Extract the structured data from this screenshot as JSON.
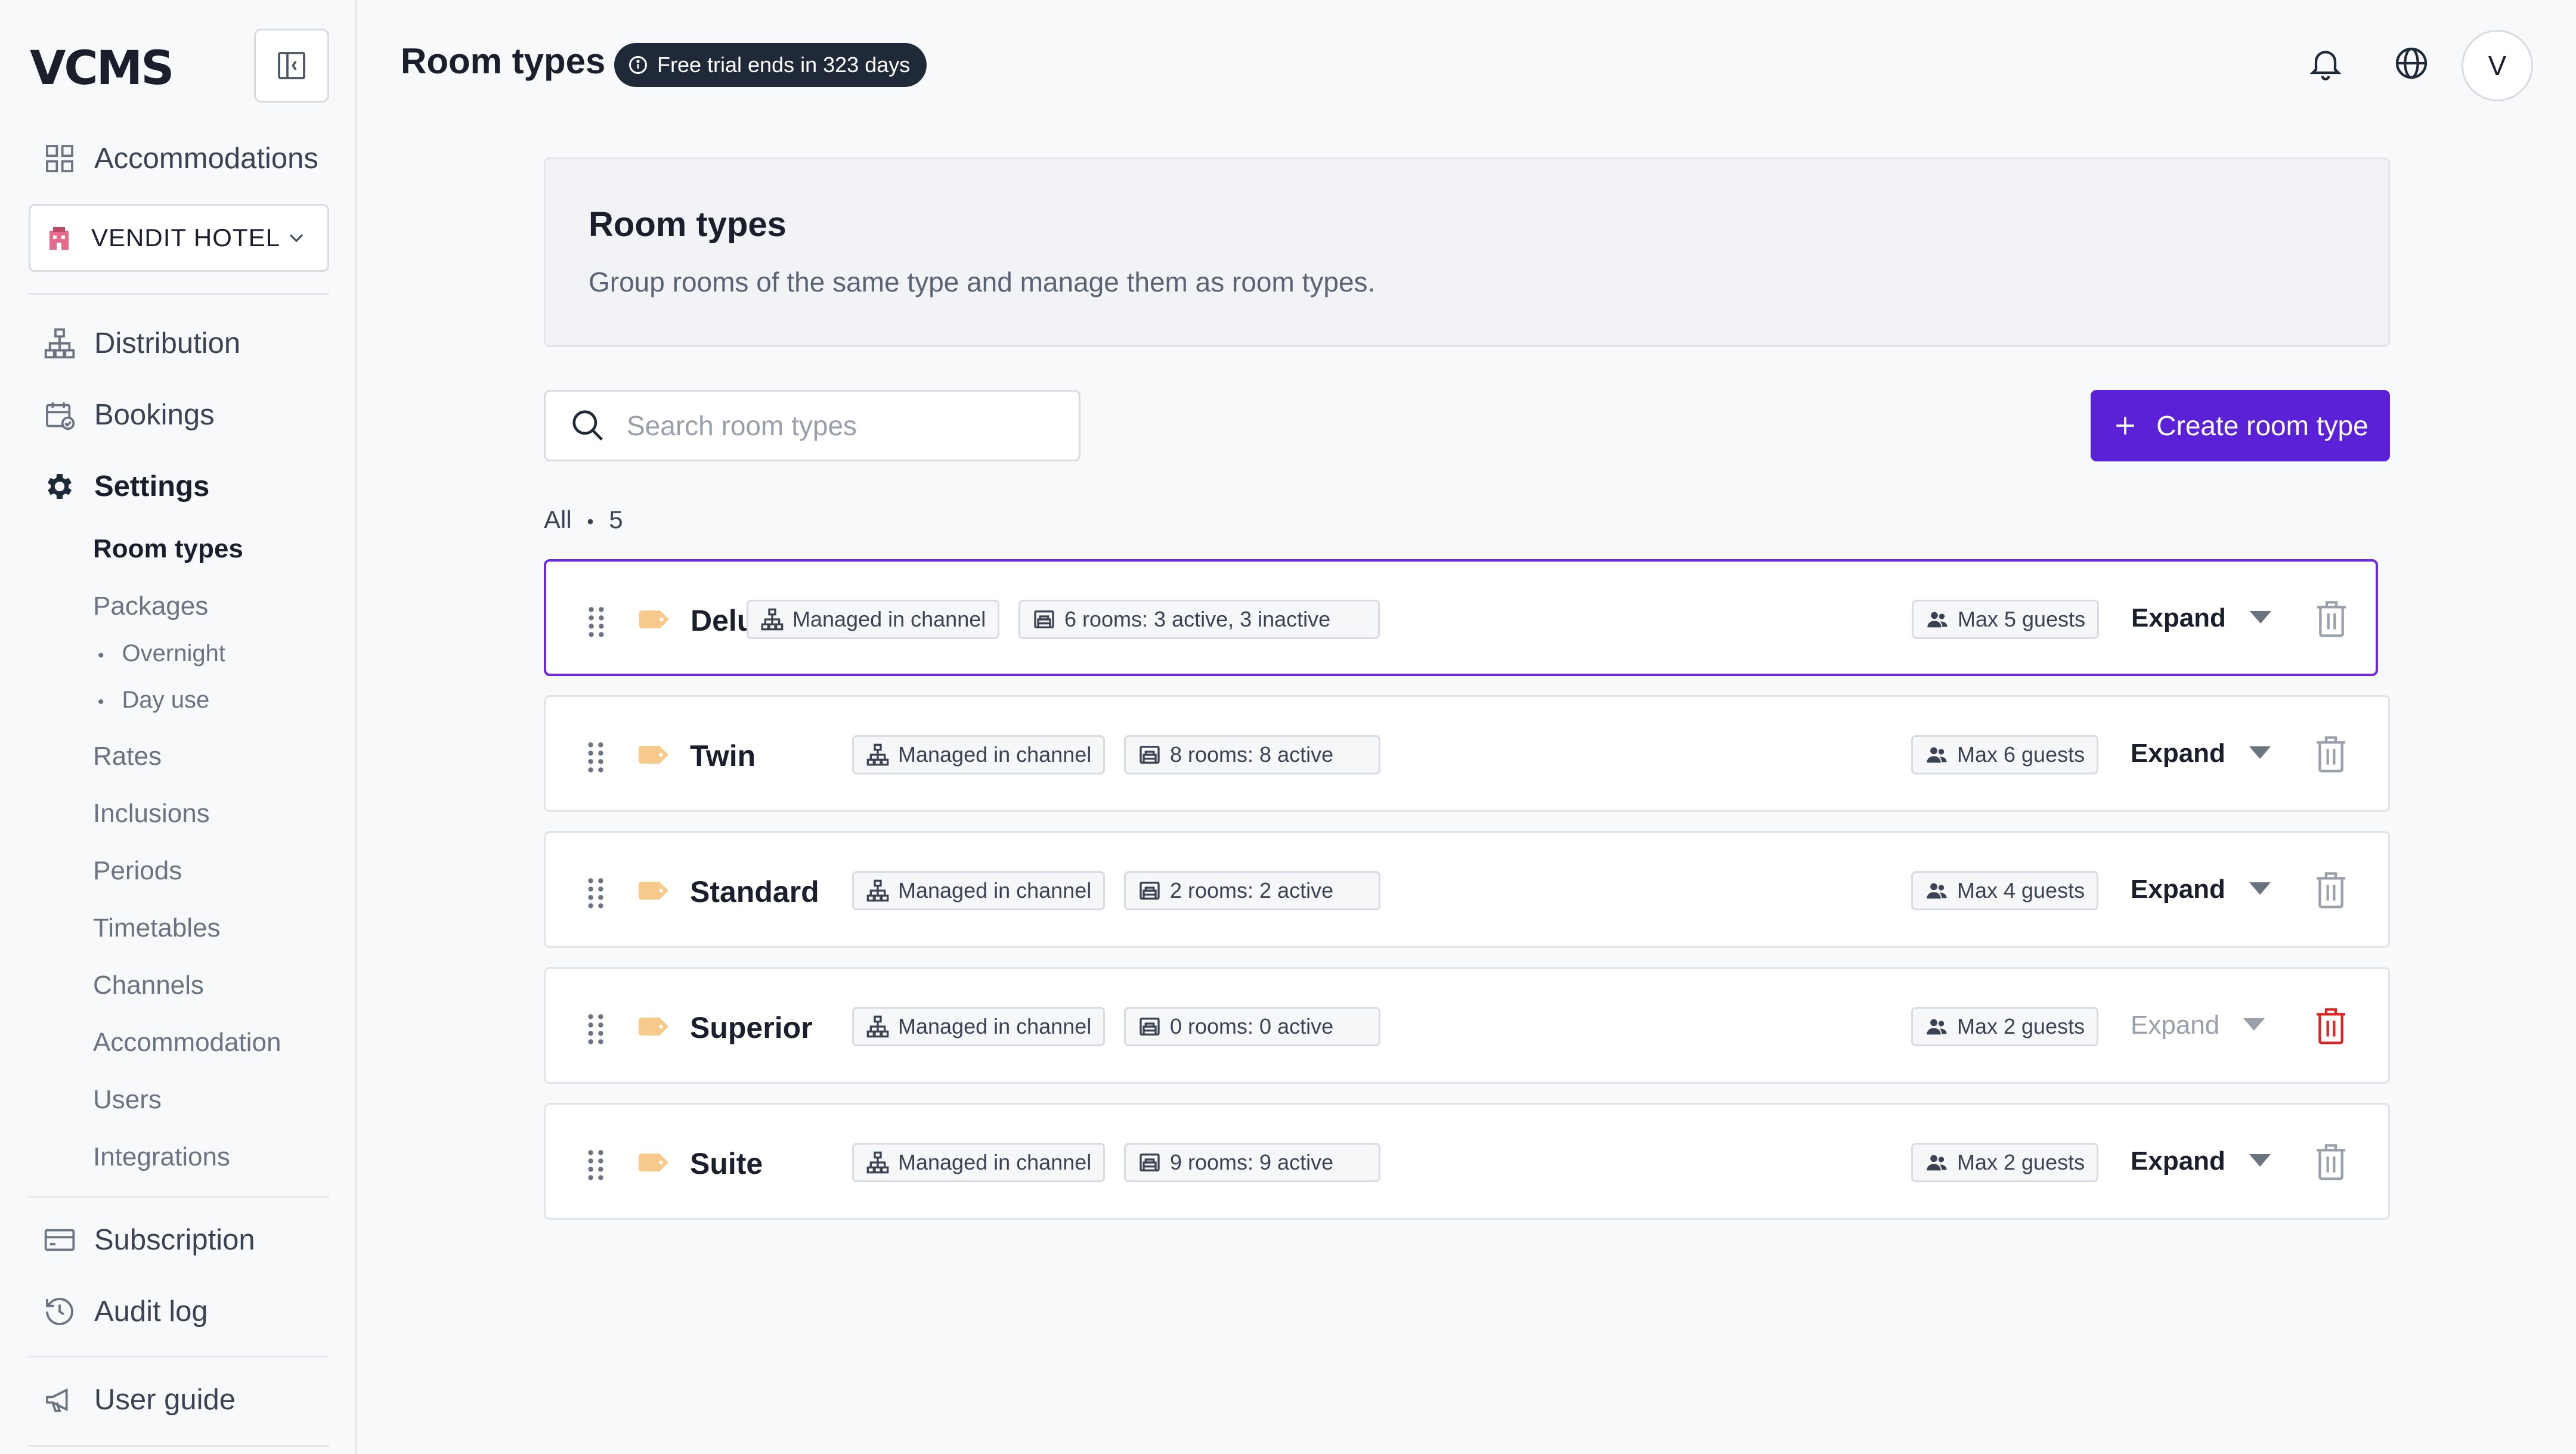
{
  "app": {
    "logo": "VCMS"
  },
  "sidebar": {
    "accommodations_label": "Accommodations",
    "hotel": "VENDIT HOTEL",
    "nav": {
      "distribution": "Distribution",
      "bookings": "Bookings",
      "settings": "Settings",
      "subscription": "Subscription",
      "audit_log": "Audit log",
      "user_guide": "User guide"
    },
    "settings_items": {
      "room_types": "Room types",
      "packages": "Packages",
      "overnight": "Overnight",
      "day_use": "Day use",
      "rates": "Rates",
      "inclusions": "Inclusions",
      "periods": "Periods",
      "timetables": "Timetables",
      "channels": "Channels",
      "accommodation": "Accommodation",
      "users": "Users",
      "integrations": "Integrations"
    }
  },
  "header": {
    "title": "Room types",
    "trial_badge": "Free trial ends in 323 days",
    "avatar_initial": "V"
  },
  "intro": {
    "title": "Room types",
    "description": "Group rooms of the same type and manage them as room types."
  },
  "search": {
    "placeholder": "Search room types"
  },
  "create_button": "Create room type",
  "filter": {
    "label": "All",
    "separator": "•",
    "count": "5"
  },
  "rows": [
    {
      "name": "Deluxe",
      "managed": "Managed in channel",
      "rooms": "6 rooms: 3 active, 3 inactive",
      "guests": "Max 5 guests",
      "expand": "Expand"
    },
    {
      "name": "Twin",
      "managed": "Managed in channel",
      "rooms": "8 rooms: 8 active",
      "guests": "Max 6 guests",
      "expand": "Expand"
    },
    {
      "name": "Standard",
      "managed": "Managed in channel",
      "rooms": "2 rooms: 2 active",
      "guests": "Max 4 guests",
      "expand": "Expand"
    },
    {
      "name": "Superior",
      "managed": "Managed in channel",
      "rooms": "0 rooms: 0 active",
      "guests": "Max 2 guests",
      "expand": "Expand"
    },
    {
      "name": "Suite",
      "managed": "Managed in channel",
      "rooms": "9 rooms: 9 active",
      "guests": "Max 2 guests",
      "expand": "Expand"
    }
  ],
  "colors": {
    "accent": "#5b21d6",
    "danger": "#e02424",
    "tag": "#f7c98b"
  }
}
